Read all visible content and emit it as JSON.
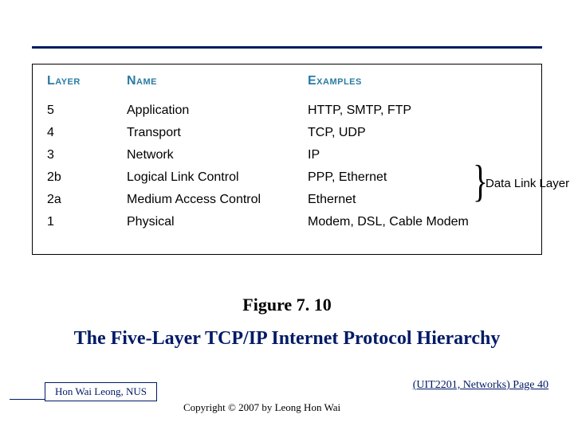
{
  "table": {
    "headers": {
      "layer": "Layer",
      "name": "Name",
      "examples": "Examples"
    },
    "rows": [
      {
        "layer": "5",
        "name": "Application",
        "examples": "HTTP, SMTP, FTP"
      },
      {
        "layer": "4",
        "name": "Transport",
        "examples": "TCP, UDP"
      },
      {
        "layer": "3",
        "name": "Network",
        "examples": "IP"
      },
      {
        "layer": "2b",
        "name": "Logical Link Control",
        "examples": "PPP, Ethernet"
      },
      {
        "layer": "2a",
        "name": "Medium Access Control",
        "examples": "Ethernet"
      },
      {
        "layer": "1",
        "name": "Physical",
        "examples": "Modem, DSL, Cable Modem"
      }
    ],
    "brace_label": "Data Link Layer"
  },
  "caption": {
    "fig": "Figure 7. 10",
    "title": "The Five-Layer TCP/IP Internet Protocol Hierarchy"
  },
  "footer": {
    "author": "Hon Wai Leong, NUS",
    "copyright": "Copyright © 2007 by Leong Hon Wai",
    "pageref": "(UIT2201, Networks) Page 40"
  }
}
